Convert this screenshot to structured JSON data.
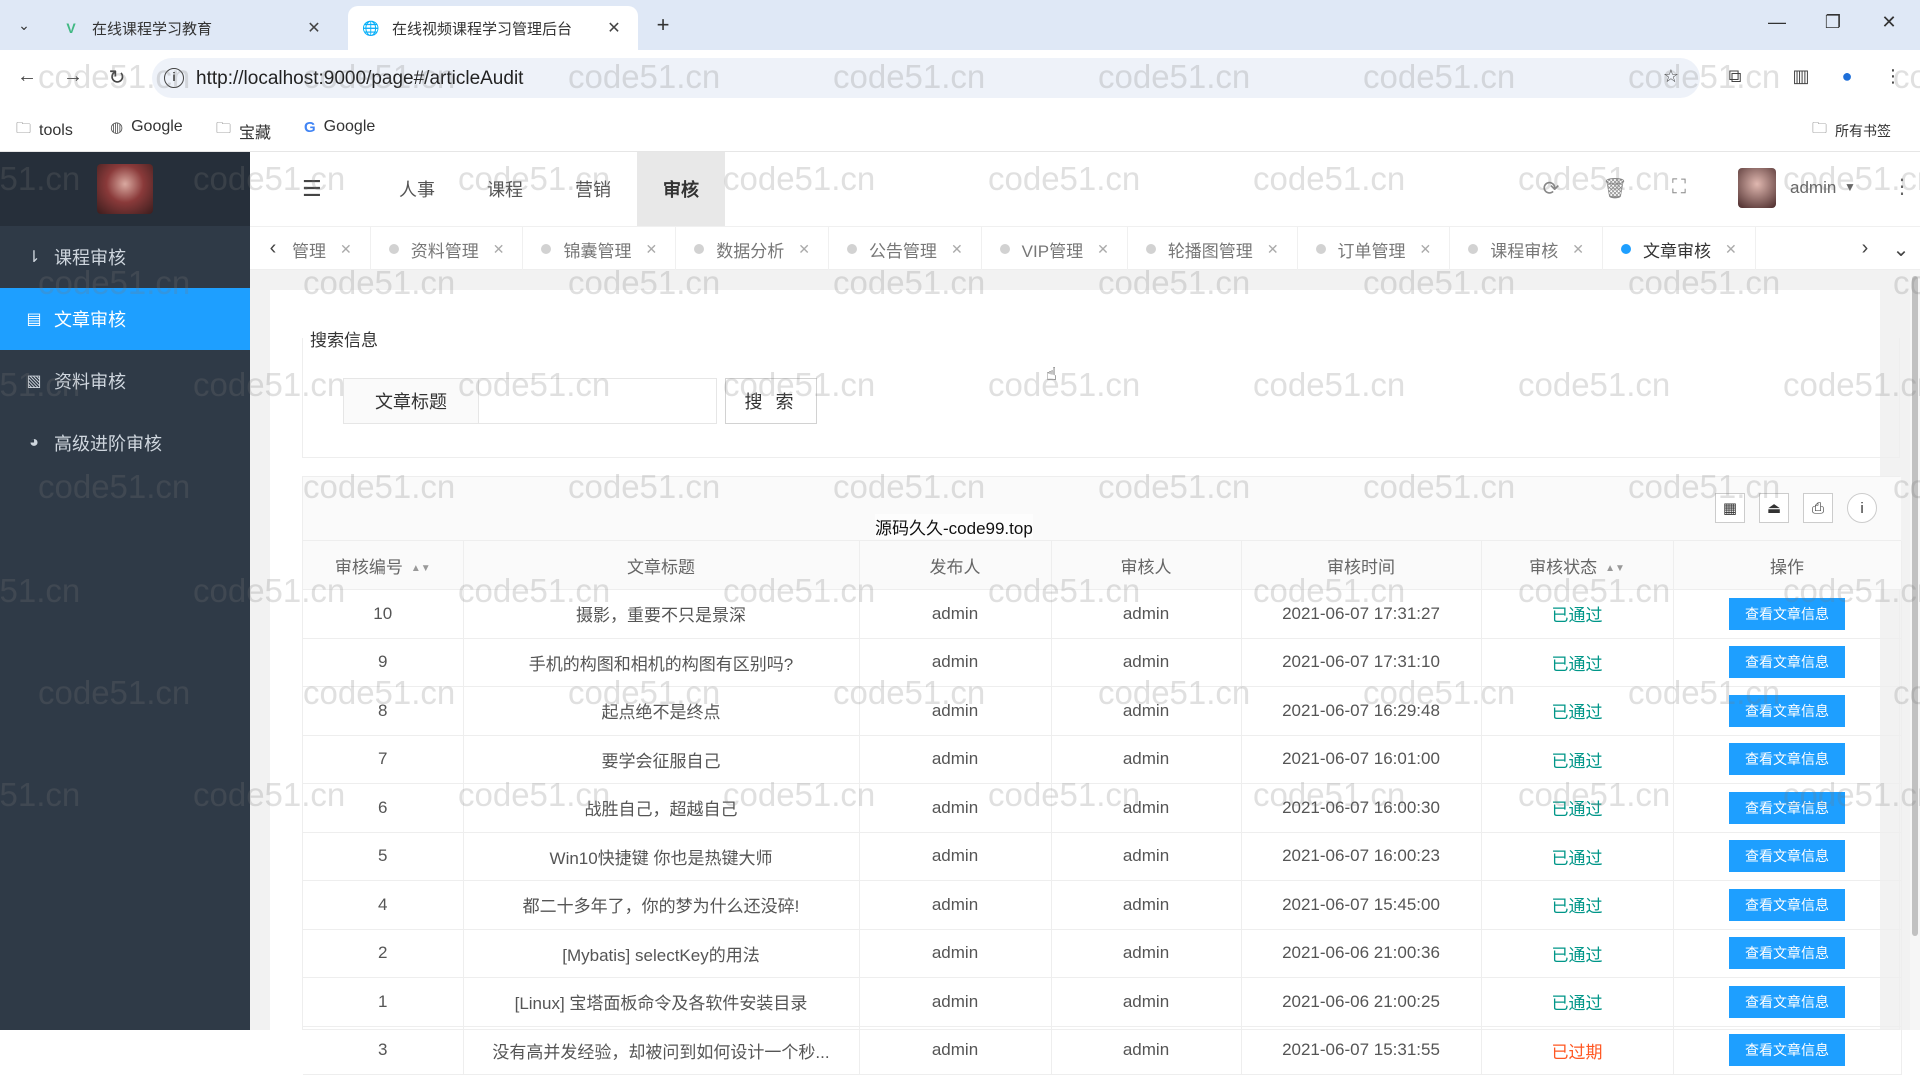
{
  "browser": {
    "tabs": [
      {
        "title": "在线课程学习教育",
        "favicon": "vue-logo-icon"
      },
      {
        "title": "在线视频课程学习管理后台",
        "favicon": "globe-icon"
      }
    ],
    "url": "http://localhost:9000/page#/articleAudit",
    "bookmarks": [
      "tools",
      "Google",
      "宝藏",
      "Google"
    ],
    "all_bookmarks": "所有书签"
  },
  "sidebar": {
    "items": [
      {
        "label": "课程审核",
        "icon": "sort-list-icon"
      },
      {
        "label": "文章审核",
        "icon": "book-icon"
      },
      {
        "label": "资料审核",
        "icon": "document-icon"
      },
      {
        "label": "高级进阶审核",
        "icon": "dashboard-icon"
      }
    ]
  },
  "topnav": {
    "menu": [
      "人事",
      "课程",
      "营销",
      "审核"
    ],
    "user": "admin"
  },
  "page_tabs": [
    "管理",
    "资料管理",
    "锦囊管理",
    "数据分析",
    "公告管理",
    "VIP管理",
    "轮播图管理",
    "订单管理",
    "课程审核",
    "文章审核"
  ],
  "search": {
    "section_title": "搜索信息",
    "field_label": "文章标题",
    "field_value": "",
    "button": "搜 索"
  },
  "table": {
    "columns": [
      "审核编号",
      "文章标题",
      "发布人",
      "审核人",
      "审核时间",
      "审核状态",
      "操作"
    ],
    "action_label": "查看文章信息",
    "rows": [
      {
        "id": "10",
        "title": "摄影，重要不只是景深",
        "publisher": "admin",
        "auditor": "admin",
        "time": "2021-06-07 17:31:27",
        "status": "已通过"
      },
      {
        "id": "9",
        "title": "手机的构图和相机的构图有区别吗?",
        "publisher": "admin",
        "auditor": "admin",
        "time": "2021-06-07 17:31:10",
        "status": "已通过"
      },
      {
        "id": "8",
        "title": "起点绝不是终点",
        "publisher": "admin",
        "auditor": "admin",
        "time": "2021-06-07 16:29:48",
        "status": "已通过"
      },
      {
        "id": "7",
        "title": "要学会征服自己",
        "publisher": "admin",
        "auditor": "admin",
        "time": "2021-06-07 16:01:00",
        "status": "已通过"
      },
      {
        "id": "6",
        "title": "战胜自己，超越自己",
        "publisher": "admin",
        "auditor": "admin",
        "time": "2021-06-07 16:00:30",
        "status": "已通过"
      },
      {
        "id": "5",
        "title": "Win10快捷键 你也是热键大师",
        "publisher": "admin",
        "auditor": "admin",
        "time": "2021-06-07 16:00:23",
        "status": "已通过"
      },
      {
        "id": "4",
        "title": "都二十多年了，你的梦为什么还没碎!",
        "publisher": "admin",
        "auditor": "admin",
        "time": "2021-06-07 15:45:00",
        "status": "已通过"
      },
      {
        "id": "2",
        "title": "[Mybatis] selectKey的用法",
        "publisher": "admin",
        "auditor": "admin",
        "time": "2021-06-06 21:00:36",
        "status": "已通过"
      },
      {
        "id": "1",
        "title": "[Linux] 宝塔面板命令及各软件安装目录",
        "publisher": "admin",
        "auditor": "admin",
        "time": "2021-06-06 21:00:25",
        "status": "已通过"
      },
      {
        "id": "3",
        "title": "没有高并发经验，却被问到如何设计一个秒...",
        "publisher": "admin",
        "auditor": "admin",
        "time": "2021-06-07 15:31:55",
        "status": "已过期"
      }
    ]
  },
  "overlay": "源码久久-code99.top",
  "watermark": "code51.cn",
  "colors": {
    "accent": "#1e9fff",
    "sidebar": "#2f3a47",
    "ok": "#009688",
    "expired": "#ff5722"
  }
}
